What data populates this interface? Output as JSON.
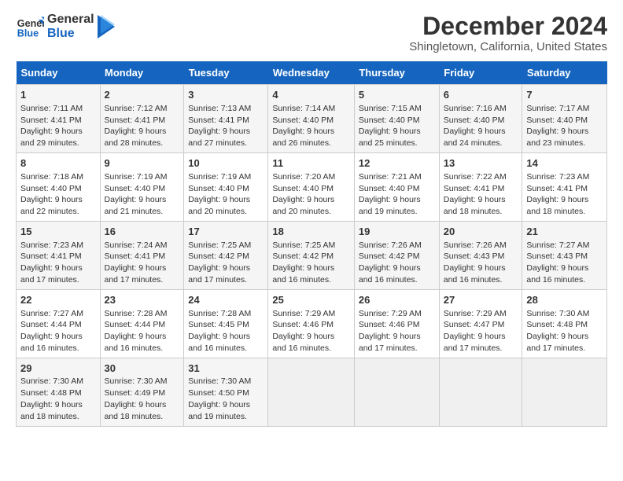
{
  "logo": {
    "line1": "General",
    "line2": "Blue"
  },
  "title": "December 2024",
  "subtitle": "Shingletown, California, United States",
  "days_of_week": [
    "Sunday",
    "Monday",
    "Tuesday",
    "Wednesday",
    "Thursday",
    "Friday",
    "Saturday"
  ],
  "weeks": [
    [
      {
        "day": 1,
        "sunrise": "7:11 AM",
        "sunset": "4:41 PM",
        "daylight": "9 hours and 29 minutes."
      },
      {
        "day": 2,
        "sunrise": "7:12 AM",
        "sunset": "4:41 PM",
        "daylight": "9 hours and 28 minutes."
      },
      {
        "day": 3,
        "sunrise": "7:13 AM",
        "sunset": "4:41 PM",
        "daylight": "9 hours and 27 minutes."
      },
      {
        "day": 4,
        "sunrise": "7:14 AM",
        "sunset": "4:40 PM",
        "daylight": "9 hours and 26 minutes."
      },
      {
        "day": 5,
        "sunrise": "7:15 AM",
        "sunset": "4:40 PM",
        "daylight": "9 hours and 25 minutes."
      },
      {
        "day": 6,
        "sunrise": "7:16 AM",
        "sunset": "4:40 PM",
        "daylight": "9 hours and 24 minutes."
      },
      {
        "day": 7,
        "sunrise": "7:17 AM",
        "sunset": "4:40 PM",
        "daylight": "9 hours and 23 minutes."
      }
    ],
    [
      {
        "day": 8,
        "sunrise": "7:18 AM",
        "sunset": "4:40 PM",
        "daylight": "9 hours and 22 minutes."
      },
      {
        "day": 9,
        "sunrise": "7:19 AM",
        "sunset": "4:40 PM",
        "daylight": "9 hours and 21 minutes."
      },
      {
        "day": 10,
        "sunrise": "7:19 AM",
        "sunset": "4:40 PM",
        "daylight": "9 hours and 20 minutes."
      },
      {
        "day": 11,
        "sunrise": "7:20 AM",
        "sunset": "4:40 PM",
        "daylight": "9 hours and 20 minutes."
      },
      {
        "day": 12,
        "sunrise": "7:21 AM",
        "sunset": "4:40 PM",
        "daylight": "9 hours and 19 minutes."
      },
      {
        "day": 13,
        "sunrise": "7:22 AM",
        "sunset": "4:41 PM",
        "daylight": "9 hours and 18 minutes."
      },
      {
        "day": 14,
        "sunrise": "7:23 AM",
        "sunset": "4:41 PM",
        "daylight": "9 hours and 18 minutes."
      }
    ],
    [
      {
        "day": 15,
        "sunrise": "7:23 AM",
        "sunset": "4:41 PM",
        "daylight": "9 hours and 17 minutes."
      },
      {
        "day": 16,
        "sunrise": "7:24 AM",
        "sunset": "4:41 PM",
        "daylight": "9 hours and 17 minutes."
      },
      {
        "day": 17,
        "sunrise": "7:25 AM",
        "sunset": "4:42 PM",
        "daylight": "9 hours and 17 minutes."
      },
      {
        "day": 18,
        "sunrise": "7:25 AM",
        "sunset": "4:42 PM",
        "daylight": "9 hours and 16 minutes."
      },
      {
        "day": 19,
        "sunrise": "7:26 AM",
        "sunset": "4:42 PM",
        "daylight": "9 hours and 16 minutes."
      },
      {
        "day": 20,
        "sunrise": "7:26 AM",
        "sunset": "4:43 PM",
        "daylight": "9 hours and 16 minutes."
      },
      {
        "day": 21,
        "sunrise": "7:27 AM",
        "sunset": "4:43 PM",
        "daylight": "9 hours and 16 minutes."
      }
    ],
    [
      {
        "day": 22,
        "sunrise": "7:27 AM",
        "sunset": "4:44 PM",
        "daylight": "9 hours and 16 minutes."
      },
      {
        "day": 23,
        "sunrise": "7:28 AM",
        "sunset": "4:44 PM",
        "daylight": "9 hours and 16 minutes."
      },
      {
        "day": 24,
        "sunrise": "7:28 AM",
        "sunset": "4:45 PM",
        "daylight": "9 hours and 16 minutes."
      },
      {
        "day": 25,
        "sunrise": "7:29 AM",
        "sunset": "4:46 PM",
        "daylight": "9 hours and 16 minutes."
      },
      {
        "day": 26,
        "sunrise": "7:29 AM",
        "sunset": "4:46 PM",
        "daylight": "9 hours and 17 minutes."
      },
      {
        "day": 27,
        "sunrise": "7:29 AM",
        "sunset": "4:47 PM",
        "daylight": "9 hours and 17 minutes."
      },
      {
        "day": 28,
        "sunrise": "7:30 AM",
        "sunset": "4:48 PM",
        "daylight": "9 hours and 17 minutes."
      }
    ],
    [
      {
        "day": 29,
        "sunrise": "7:30 AM",
        "sunset": "4:48 PM",
        "daylight": "9 hours and 18 minutes."
      },
      {
        "day": 30,
        "sunrise": "7:30 AM",
        "sunset": "4:49 PM",
        "daylight": "9 hours and 18 minutes."
      },
      {
        "day": 31,
        "sunrise": "7:30 AM",
        "sunset": "4:50 PM",
        "daylight": "9 hours and 19 minutes."
      },
      null,
      null,
      null,
      null
    ]
  ],
  "labels": {
    "sunrise": "Sunrise:",
    "sunset": "Sunset:",
    "daylight": "Daylight:"
  }
}
